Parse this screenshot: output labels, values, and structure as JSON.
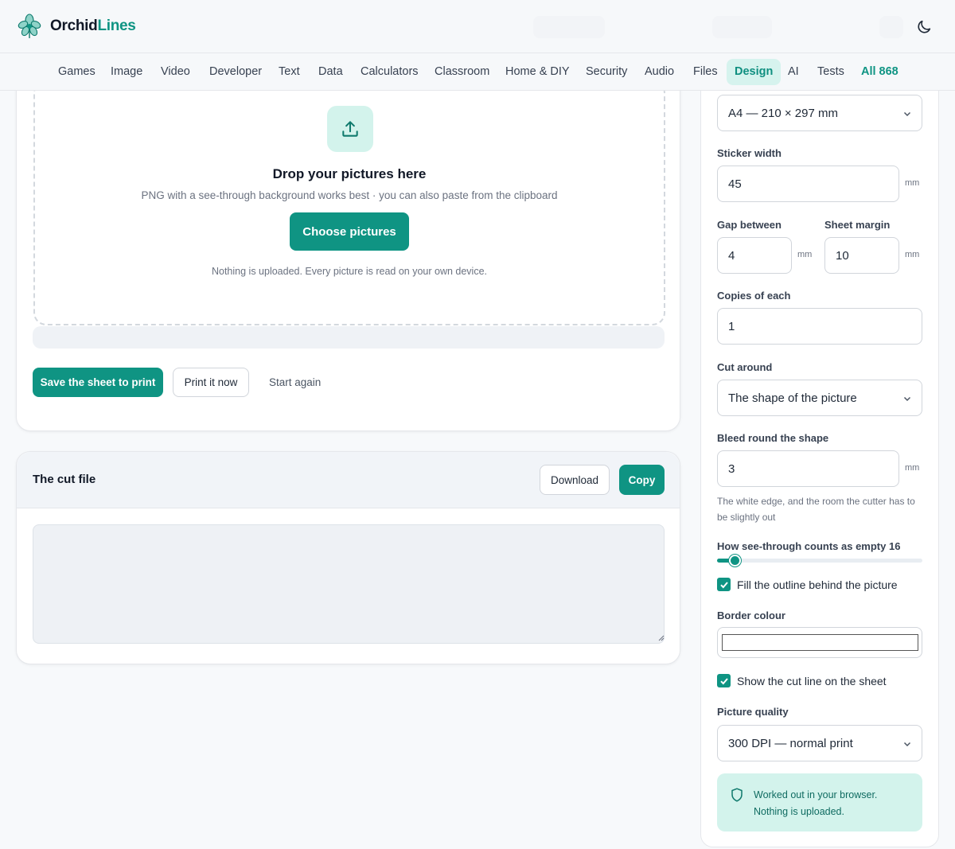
{
  "brand": {
    "name_a": "Orchid",
    "name_b": "Lines"
  },
  "nav": {
    "items": [
      "Games",
      "Image",
      "Video",
      "Developer",
      "Text",
      "Data",
      "Calculators",
      "Classroom",
      "Home & DIY",
      "Security",
      "Audio",
      "Files",
      "Design",
      "AI",
      "Tests"
    ],
    "active": "Design",
    "all_label": "All 868"
  },
  "upload": {
    "title": "Drop your pictures here",
    "subtitle": "PNG with a see-through background works best · you can also paste from the clipboard",
    "choose_label": "Choose pictures",
    "note": "Nothing is uploaded. Every picture is read on your own device."
  },
  "actions": {
    "save_label": "Save the sheet to print",
    "print_label": "Print it now",
    "restart_label": "Start again"
  },
  "cut_file": {
    "title": "The cut file",
    "download_label": "Download",
    "copy_label": "Copy",
    "content": ""
  },
  "settings": {
    "paper_value": "A4 — 210 × 297 mm",
    "sticker_width_label": "Sticker width",
    "sticker_width_value": "45",
    "gap_label": "Gap between",
    "gap_value": "4",
    "margin_label": "Sheet margin",
    "margin_value": "10",
    "copies_label": "Copies of each",
    "copies_value": "1",
    "cut_around_label": "Cut around",
    "cut_around_value": "The shape of the picture",
    "bleed_label": "Bleed round the shape",
    "bleed_value": "3",
    "bleed_hint": "The white edge, and the room the cutter has to be slightly out",
    "transparency_label": "How see-through counts as empty",
    "transparency_value": "16",
    "transparency_fraction": 0.063,
    "fill_outline_label": "Fill the outline behind the picture",
    "fill_outline_checked": true,
    "border_colour_label": "Border colour",
    "border_colour_value": "#ffffff",
    "show_cutline_label": "Show the cut line on the sheet",
    "show_cutline_checked": true,
    "quality_label": "Picture quality",
    "quality_value": "300 DPI — normal print",
    "unit": "mm"
  },
  "privacy": {
    "line1": "Worked out in your browser.",
    "line2": "Nothing is uploaded."
  },
  "colors": {
    "accent": "#0f9483",
    "accent_soft": "#d3f3ec"
  }
}
